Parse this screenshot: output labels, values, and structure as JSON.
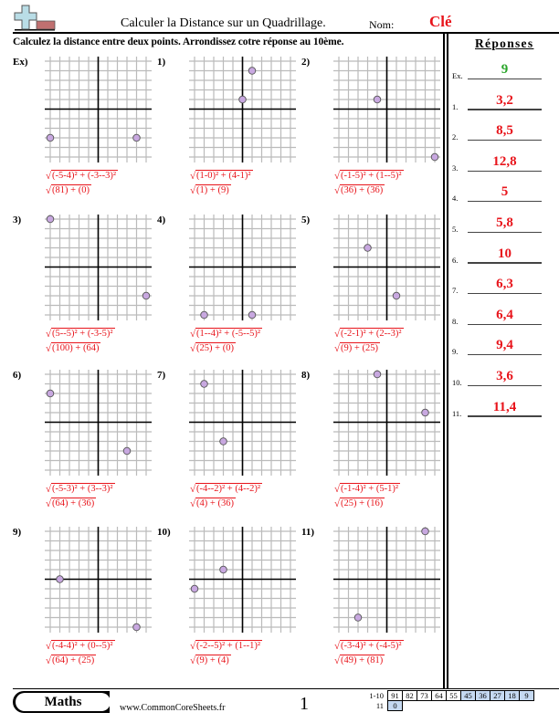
{
  "header": {
    "title": "Calculer la Distance sur un Quadrillage.",
    "name_label": "Nom:",
    "name_value": "Clé",
    "logo_icon": "plus-cross-logo-icon"
  },
  "instructions": "Calculez la distance entre deux points. Arrondissez cotre réponse au 10ème.",
  "grid": {
    "min": -5,
    "max": 5
  },
  "colors": {
    "answer_red": "#e8141b",
    "example_green": "#2aa52a",
    "point_fill": "#c8a8e0",
    "score_blue": "#c5d9f1",
    "logo_blue": "#b9dde6",
    "logo_red": "#c07070"
  },
  "problems": [
    {
      "label": "Ex)",
      "points": [
        [
          -5,
          -3
        ],
        [
          4,
          -3
        ]
      ],
      "formula1": "(-5-4)² + (-3--3)²",
      "formula2": "(81) + (0)"
    },
    {
      "label": "1)",
      "points": [
        [
          1,
          4
        ],
        [
          0,
          1
        ]
      ],
      "formula1": "(1-0)² + (4-1)²",
      "formula2": "(1) + (9)"
    },
    {
      "label": "2)",
      "points": [
        [
          -1,
          1
        ],
        [
          5,
          -5
        ]
      ],
      "formula1": "(-1-5)² + (1--5)²",
      "formula2": "(36) + (36)"
    },
    {
      "label": "3)",
      "points": [
        [
          5,
          -3
        ],
        [
          -5,
          5
        ]
      ],
      "formula1": "(5--5)² + (-3-5)²",
      "formula2": "(100) + (64)"
    },
    {
      "label": "4)",
      "points": [
        [
          1,
          -5
        ],
        [
          -4,
          -5
        ]
      ],
      "formula1": "(1--4)² + (-5--5)²",
      "formula2": "(25) + (0)"
    },
    {
      "label": "5)",
      "points": [
        [
          -2,
          2
        ],
        [
          1,
          -3
        ]
      ],
      "formula1": "(-2-1)² + (2--3)²",
      "formula2": "(9) + (25)"
    },
    {
      "label": "6)",
      "points": [
        [
          -5,
          3
        ],
        [
          3,
          -3
        ]
      ],
      "formula1": "(-5-3)² + (3--3)²",
      "formula2": "(64) + (36)"
    },
    {
      "label": "7)",
      "points": [
        [
          -4,
          4
        ],
        [
          -2,
          -2
        ]
      ],
      "formula1": "(-4--2)² + (4--2)²",
      "formula2": "(4) + (36)"
    },
    {
      "label": "8)",
      "points": [
        [
          -1,
          5
        ],
        [
          4,
          1
        ]
      ],
      "formula1": "(-1-4)² + (5-1)²",
      "formula2": "(25) + (16)"
    },
    {
      "label": "9)",
      "points": [
        [
          -4,
          0
        ],
        [
          4,
          -5
        ]
      ],
      "formula1": "(-4-4)² + (0--5)²",
      "formula2": "(64) + (25)"
    },
    {
      "label": "10)",
      "points": [
        [
          -2,
          1
        ],
        [
          -5,
          -1
        ]
      ],
      "formula1": "(-2--5)² + (1--1)²",
      "formula2": "(9) + (4)"
    },
    {
      "label": "11)",
      "points": [
        [
          -3,
          -4
        ],
        [
          4,
          5
        ]
      ],
      "formula1": "(-3-4)² + (-4-5)²",
      "formula2": "(49) + (81)"
    }
  ],
  "answers": {
    "title": "Réponses",
    "items": [
      {
        "num": "Ex.",
        "value": "9"
      },
      {
        "num": "1.",
        "value": "3,2"
      },
      {
        "num": "2.",
        "value": "8,5"
      },
      {
        "num": "3.",
        "value": "12,8"
      },
      {
        "num": "4.",
        "value": "5"
      },
      {
        "num": "5.",
        "value": "5,8"
      },
      {
        "num": "6.",
        "value": "10"
      },
      {
        "num": "7.",
        "value": "6,3"
      },
      {
        "num": "8.",
        "value": "6,4"
      },
      {
        "num": "9.",
        "value": "9,4"
      },
      {
        "num": "10.",
        "value": "3,6"
      },
      {
        "num": "11.",
        "value": "11,4"
      }
    ]
  },
  "footer": {
    "badge": "Maths",
    "url": "www.CommonCoreSheets.fr",
    "page": "1",
    "score_rows": [
      {
        "label": "1-10",
        "cells": [
          "91",
          "82",
          "73",
          "64",
          "55",
          "45",
          "36",
          "27",
          "18",
          "9"
        ],
        "highlight_from": 5
      },
      {
        "label": "11",
        "cells": [
          "0"
        ],
        "highlight_from": 0
      }
    ]
  }
}
